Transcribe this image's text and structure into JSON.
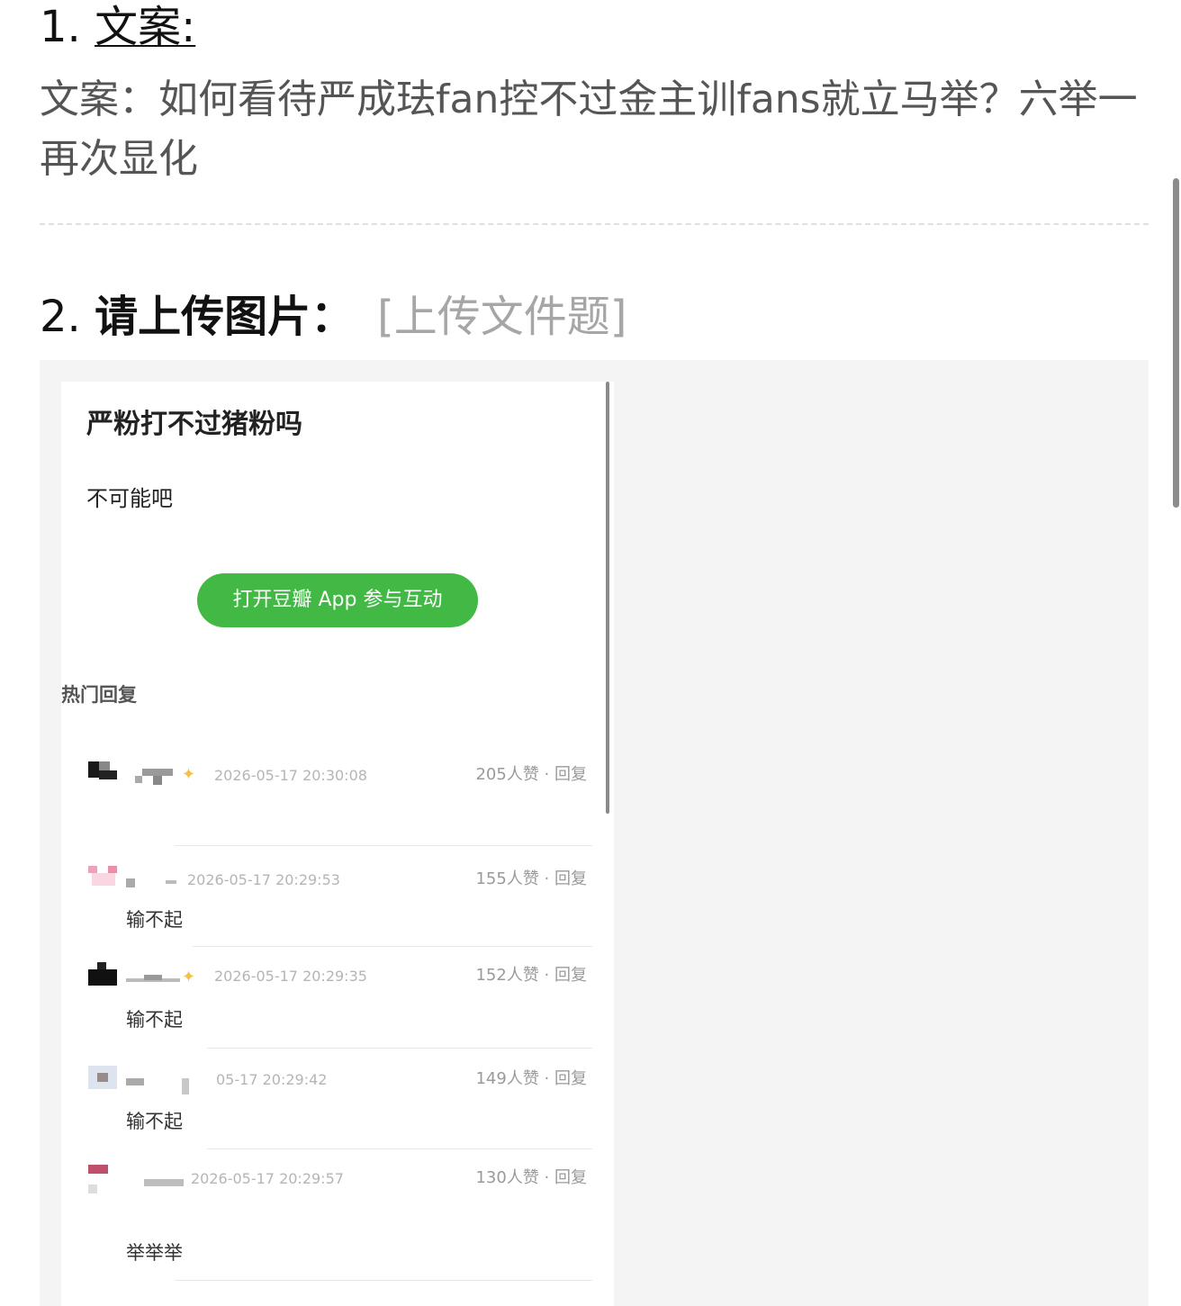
{
  "q1": {
    "number": "1.",
    "label": "文案:",
    "answer": "文案：如何看待严成珐fan控不过金主训fans就立马举？六举一再次显化"
  },
  "q2": {
    "number": "2.",
    "label": "请上传图片：",
    "type_tag": "[上传文件题]"
  },
  "screenshot": {
    "post_title": "严粉打不过猪粉吗",
    "post_body": "不可能吧",
    "app_button": "打开豆瓣 App 参与互动",
    "hot_replies_label": "热门回复",
    "comments": [
      {
        "time": "2026-05-17 20:30:08",
        "likes": "205人赞 · 回复",
        "text": ""
      },
      {
        "time": "2026-05-17 20:29:53",
        "likes": "155人赞 · 回复",
        "text": "输不起"
      },
      {
        "time": "2026-05-17 20:29:35",
        "likes": "152人赞 · 回复",
        "text": "输不起"
      },
      {
        "time": "05-17 20:29:42",
        "likes": "149人赞 · 回复",
        "text": "输不起"
      },
      {
        "time": "2026-05-17 20:29:57",
        "likes": "130人赞 · 回复",
        "text": "举举举"
      }
    ]
  },
  "colors": {
    "accent_green": "#42b845",
    "muted": "#a6a6a6",
    "upload_bg": "#f4f4f4"
  }
}
